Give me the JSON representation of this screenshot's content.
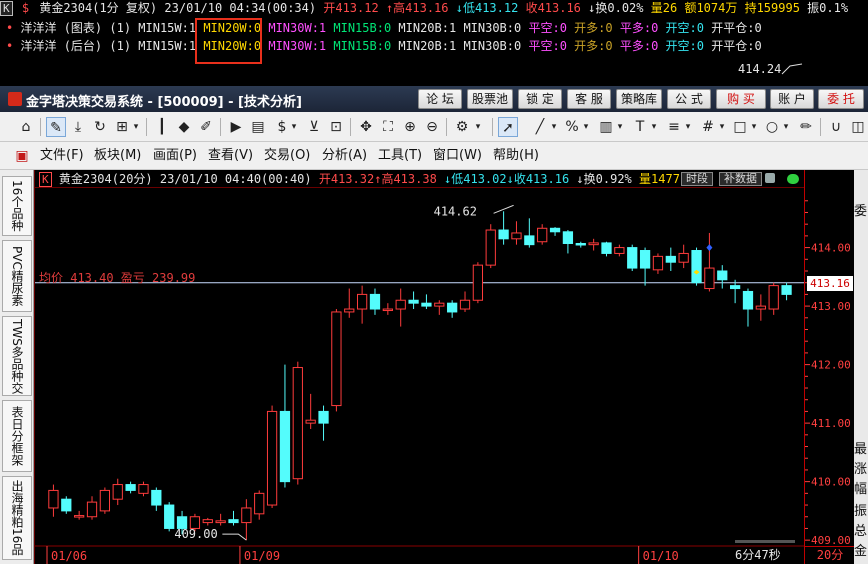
{
  "top": {
    "line1": {
      "k": "K",
      "symbol_prefix": "$",
      "name": "黄金2304",
      "period": "(1分",
      "adj": "复权)",
      "datetime": "23/01/10 04:34(00:34)",
      "open": "开413.12",
      "high": "↑高413.16",
      "low": "↓低413.12",
      "close": "收413.16",
      "turnover": "↓换0.02%",
      "volume": "量26",
      "amount": "额1074万",
      "hold": "持159995",
      "amp": "振0.1%"
    },
    "line2": {
      "label": "洋洋洋 (图表) (1)",
      "items": [
        "MIN15W:1",
        "MIN20W:0",
        "MIN30W:1",
        "MIN15B:0",
        "MIN20B:1",
        "MIN30B:0",
        "平空:0",
        "开多:0",
        "平多:0",
        "开空:0",
        "开平仓:0"
      ]
    },
    "line3": {
      "label": "洋洋洋 (后台) (1)",
      "items": [
        "MIN15W:1",
        "MIN20W:0",
        "MIN30W:1",
        "MIN15B:0",
        "MIN20B:1",
        "MIN30B:0",
        "平空:0",
        "开多:0",
        "平多:0",
        "开空:0",
        "开平仓:0"
      ]
    },
    "price_tag": "414.24"
  },
  "app": {
    "title": "金字塔决策交易系统 - [500009] - [技术分析]",
    "buttons": [
      "论 坛",
      "股票池",
      "锁 定",
      "客 服",
      "策略库",
      "公 式",
      "购 买",
      "账 户",
      "委 托"
    ]
  },
  "menu": [
    "文件(F)",
    "板块(M)",
    "画面(P)",
    "查看(V)",
    "交易(O)",
    "分析(A)",
    "工具(T)",
    "窗口(W)",
    "帮助(H)"
  ],
  "side_tabs": [
    "16个品种",
    "PVC精尿素",
    "TWS多品种交",
    "表日分框架",
    "出海精粕16品"
  ],
  "chart_header": {
    "k": "K",
    "name": "黄金2304(20分)",
    "datetime": "23/01/10 04:40(00:40)",
    "open": "开413.32",
    "high": "↑高413.38",
    "low": "↓低413.02",
    "close": "↓收413.16",
    "turnover": "↓换0.92%",
    "volume": "量1477",
    "btn_time": "时段",
    "btn_data": "补数据"
  },
  "avg_label": "均价 413.40 盈亏 239.99",
  "high_label": "414.62",
  "low_label": "409.00",
  "timer": "6分47秒",
  "current_price": "413.16",
  "period_label": "20分",
  "right_panel_chars": [
    "委",
    "最",
    "涨",
    "幅",
    "振",
    "总",
    "金"
  ],
  "colors": {
    "up": "#ff3c3c",
    "down": "#54fcfc",
    "grid": "#8a0000",
    "axis": "#ff4040",
    "avg": "#c8dcff"
  },
  "chart_data": {
    "type": "candlestick",
    "ylim": [
      408.9,
      414.95
    ],
    "yticks": [
      409.0,
      410.0,
      411.0,
      412.0,
      413.0,
      414.0
    ],
    "ytick_labels": [
      "409.00",
      "410.00",
      "411.00",
      "412.00",
      "413.00",
      "414.00"
    ],
    "xlabels": [
      {
        "i": 0,
        "text": "01/06"
      },
      {
        "i": 15,
        "text": "01/09"
      },
      {
        "i": 46,
        "text": "01/10"
      }
    ],
    "avg_price": 413.4,
    "candles": [
      [
        409.55,
        409.85,
        409.4,
        409.95
      ],
      [
        409.7,
        409.5,
        409.45,
        409.75
      ],
      [
        409.42,
        409.42,
        409.35,
        409.5
      ],
      [
        409.4,
        409.65,
        409.35,
        409.75
      ],
      [
        409.5,
        409.85,
        409.45,
        409.9
      ],
      [
        409.7,
        409.95,
        409.6,
        410.05
      ],
      [
        409.95,
        409.85,
        409.8,
        410.0
      ],
      [
        409.8,
        409.95,
        409.75,
        410.0
      ],
      [
        409.85,
        409.6,
        409.5,
        409.9
      ],
      [
        409.6,
        409.2,
        409.15,
        409.65
      ],
      [
        409.4,
        409.2,
        409.1,
        409.5
      ],
      [
        409.2,
        409.4,
        409.15,
        409.45
      ],
      [
        409.3,
        409.35,
        409.25,
        409.38
      ],
      [
        409.3,
        409.33,
        409.25,
        409.45
      ],
      [
        409.35,
        409.3,
        409.25,
        409.5
      ],
      [
        409.3,
        409.55,
        409.0,
        409.7
      ],
      [
        409.45,
        409.8,
        409.35,
        409.85
      ],
      [
        409.6,
        411.2,
        409.55,
        411.3
      ],
      [
        411.2,
        410.0,
        409.9,
        412.0
      ],
      [
        410.05,
        411.95,
        409.95,
        412.05
      ],
      [
        411.0,
        411.05,
        410.9,
        411.5
      ],
      [
        411.2,
        411.0,
        410.7,
        411.3
      ],
      [
        411.3,
        412.9,
        411.2,
        412.95
      ],
      [
        412.9,
        412.95,
        412.8,
        413.3
      ],
      [
        412.95,
        413.2,
        412.7,
        413.35
      ],
      [
        413.2,
        412.95,
        412.85,
        413.3
      ],
      [
        412.95,
        412.95,
        412.85,
        413.05
      ],
      [
        412.95,
        413.1,
        412.65,
        413.3
      ],
      [
        413.1,
        413.05,
        412.95,
        413.25
      ],
      [
        413.05,
        413.0,
        412.95,
        413.2
      ],
      [
        413.0,
        413.05,
        412.85,
        413.1
      ],
      [
        413.05,
        412.9,
        412.8,
        413.1
      ],
      [
        412.95,
        413.1,
        412.9,
        413.25
      ],
      [
        413.1,
        413.7,
        413.05,
        413.75
      ],
      [
        413.7,
        414.3,
        413.65,
        414.4
      ],
      [
        414.3,
        414.15,
        414.05,
        414.62
      ],
      [
        414.15,
        414.25,
        414.05,
        414.45
      ],
      [
        414.2,
        414.05,
        414.0,
        414.5
      ],
      [
        414.1,
        414.33,
        414.05,
        414.4
      ],
      [
        414.33,
        414.27,
        414.2,
        414.35
      ],
      [
        414.27,
        414.07,
        413.9,
        414.3
      ],
      [
        414.07,
        414.05,
        414.0,
        414.1
      ],
      [
        414.05,
        414.08,
        413.95,
        414.15
      ],
      [
        414.08,
        413.9,
        413.85,
        414.1
      ],
      [
        413.9,
        414.0,
        413.85,
        414.05
      ],
      [
        414.0,
        413.65,
        413.6,
        414.05
      ],
      [
        413.95,
        413.65,
        413.35,
        414.0
      ],
      [
        413.62,
        413.85,
        413.55,
        413.9
      ],
      [
        413.85,
        413.75,
        413.6,
        414.0
      ],
      [
        413.75,
        413.9,
        413.65,
        414.05
      ],
      [
        413.95,
        413.4,
        413.35,
        414.0
      ],
      [
        413.3,
        413.65,
        413.25,
        414.25
      ],
      [
        413.6,
        413.45,
        413.3,
        413.7
      ],
      [
        413.35,
        413.3,
        413.05,
        413.45
      ],
      [
        413.25,
        412.95,
        412.65,
        413.3
      ],
      [
        412.95,
        413.0,
        412.75,
        413.2
      ],
      [
        412.95,
        413.35,
        412.85,
        413.4
      ],
      [
        413.35,
        413.2,
        413.1,
        413.4
      ]
    ]
  }
}
